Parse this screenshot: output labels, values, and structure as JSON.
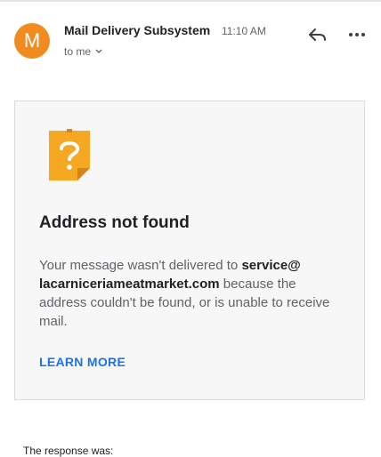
{
  "header": {
    "avatar_letter": "M",
    "avatar_color": "#f28b1e",
    "sender": "Mail Delivery Subsystem",
    "time": "11:10 AM",
    "recipient": "to me"
  },
  "card": {
    "title": "Address not found",
    "body_prefix": "Your message wasn't delivered to ",
    "email_part1": "service@",
    "email_part2": "lacarniceriameatmarket.com",
    "body_suffix": " because the address couldn't be found, or is unable to receive mail.",
    "learn_more": "LEARN MORE",
    "link_color": "#1a73e8"
  },
  "footer": {
    "response_label": "The response was:"
  },
  "icons": {
    "reply": "reply-icon",
    "more": "more-vert-icon",
    "warning": "question-note-icon"
  }
}
